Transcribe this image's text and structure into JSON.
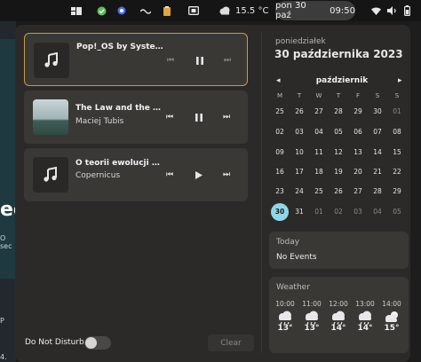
{
  "topbar": {
    "weather_temp": "15.5 °C",
    "date": "pon 30 paź",
    "time": "09:50"
  },
  "background_text": {
    "big": "ec",
    "line1": "O sec",
    "line2": "P",
    "line3": "4."
  },
  "notifications": [
    {
      "title": "Pop!_OS by Syste...",
      "artist": "",
      "art": "music-note",
      "state": "paused"
    },
    {
      "title": "The Law and the Fist ...",
      "artist": "Maciej Tubis",
      "art": "album-cover",
      "state": "paused"
    },
    {
      "title": "O teorii ewolucji ni...",
      "artist": "Copernicus",
      "art": "music-note",
      "state": "stopped"
    }
  ],
  "dnd": {
    "label": "Do Not Disturb",
    "enabled": false
  },
  "clear_label": "Clear",
  "calendar": {
    "weekday": "poniedziałek",
    "full_date": "30 października 2023",
    "month": "październik",
    "prev": "◂",
    "next": "▸",
    "dow": [
      "M",
      "T",
      "W",
      "T",
      "F",
      "S",
      "S"
    ],
    "weeks": [
      [
        "25",
        "26",
        "27",
        "28",
        "29",
        "30",
        "01"
      ],
      [
        "02",
        "03",
        "04",
        "05",
        "06",
        "07",
        "08"
      ],
      [
        "09",
        "10",
        "11",
        "12",
        "13",
        "14",
        "15"
      ],
      [
        "16",
        "17",
        "18",
        "19",
        "20",
        "21",
        "22"
      ],
      [
        "23",
        "24",
        "25",
        "26",
        "27",
        "28",
        "29"
      ],
      [
        "30",
        "31",
        "01",
        "02",
        "03",
        "04",
        "05"
      ]
    ]
  },
  "today": {
    "header": "Today",
    "body": "No Events"
  },
  "weather": {
    "header": "Weather",
    "forecast": [
      {
        "time": "10:00",
        "temp": "13°",
        "icon": "rain-cloud-icon"
      },
      {
        "time": "11:00",
        "temp": "13°",
        "icon": "rain-cloud-icon"
      },
      {
        "time": "12:00",
        "temp": "14°",
        "icon": "rain-cloud-icon"
      },
      {
        "time": "13:00",
        "temp": "14°",
        "icon": "rain-cloud-icon"
      },
      {
        "time": "14:00",
        "temp": "15°",
        "icon": "partly-cloudy-icon"
      }
    ]
  }
}
